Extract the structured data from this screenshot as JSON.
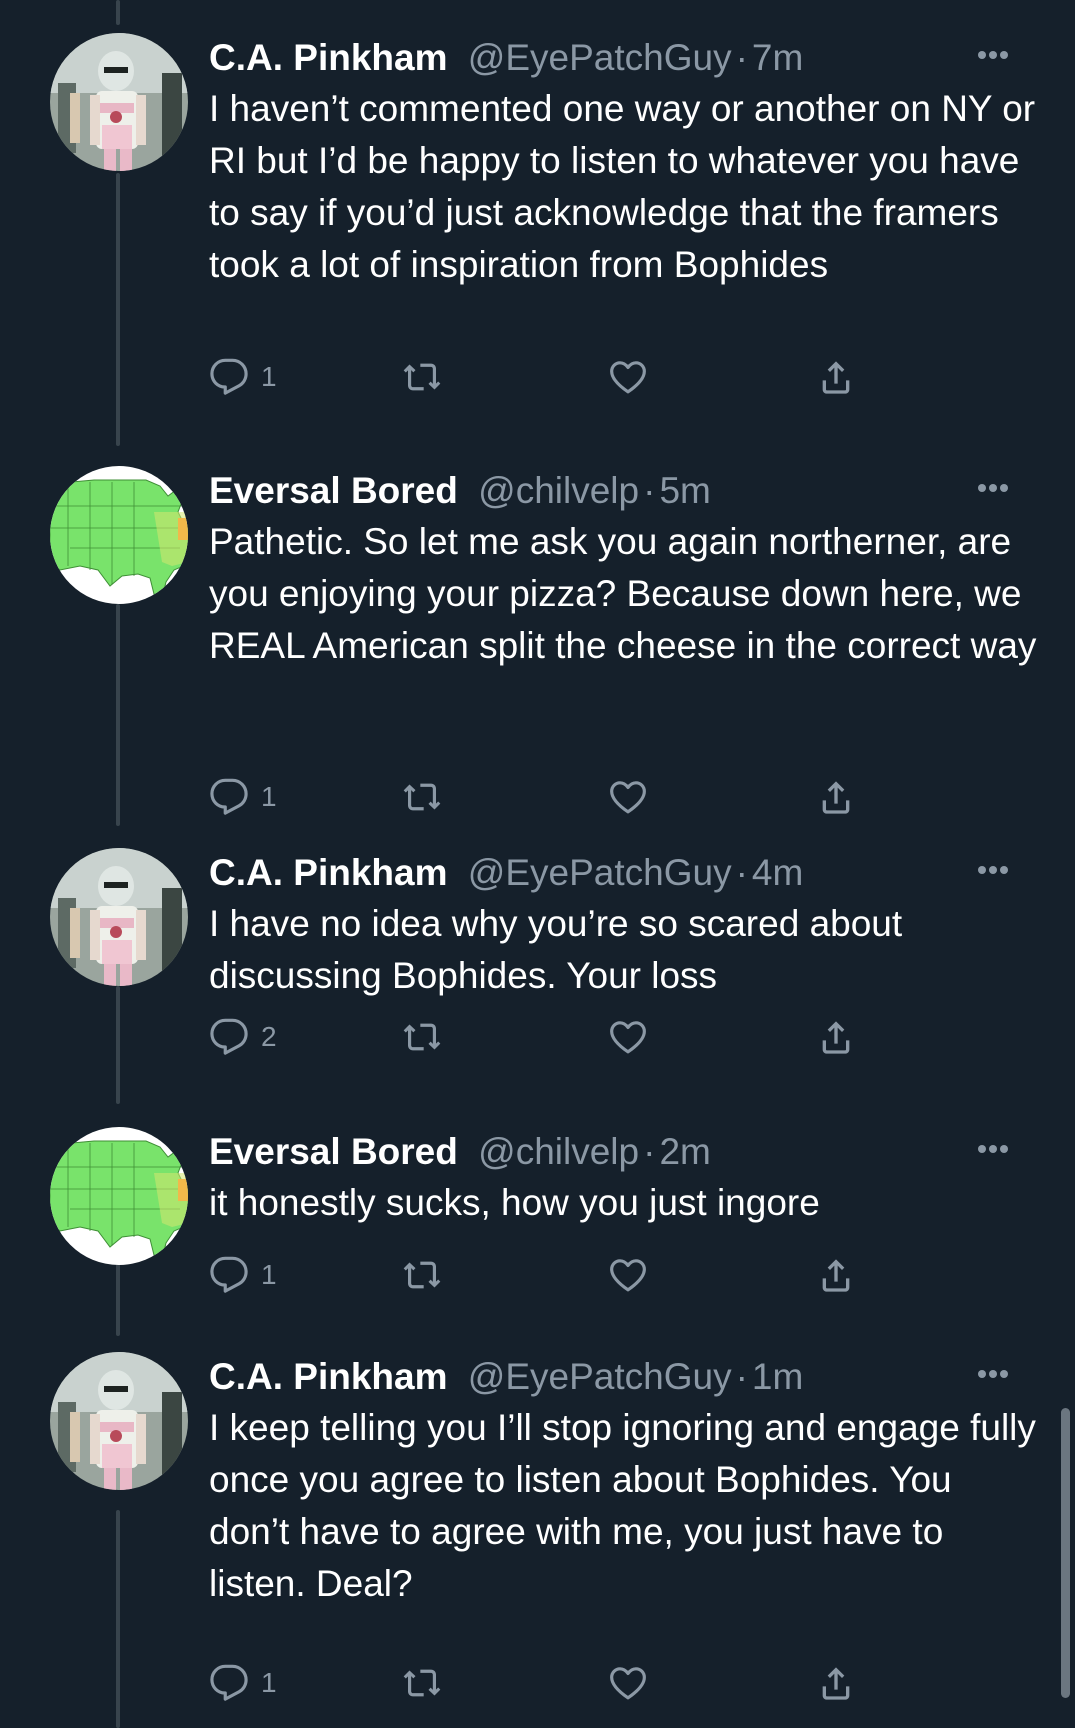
{
  "tweets": [
    {
      "name": "C.A. Pinkham",
      "handle": "@EyePatchGuy",
      "dot": "·",
      "time": "7m",
      "avatar_icon": "stormtrooper-avatar-icon",
      "text": "I haven’t commented one way or another on NY or RI but I’d be happy to listen to whatever you have to say if you’d just acknowledge that the framers took a lot of inspiration from Bophides",
      "reply_count": "1",
      "retweet_count": "",
      "like_count": ""
    },
    {
      "name": "Eversal Bored",
      "handle": "@chilvelp",
      "dot": "·",
      "time": "5m",
      "avatar_icon": "us-map-avatar-icon",
      "text": "Pathetic. So let me ask you again northerner, are you enjoying your pizza? Because down here, we REAL American split the cheese in the correct way",
      "reply_count": "1",
      "retweet_count": "",
      "like_count": ""
    },
    {
      "name": "C.A. Pinkham",
      "handle": "@EyePatchGuy",
      "dot": "·",
      "time": "4m",
      "avatar_icon": "stormtrooper-avatar-icon",
      "text": "I have no idea why you’re so scared about discussing Bophides. Your loss",
      "reply_count": "2",
      "retweet_count": "",
      "like_count": ""
    },
    {
      "name": "Eversal Bored",
      "handle": "@chilvelp",
      "dot": "·",
      "time": "2m",
      "avatar_icon": "us-map-avatar-icon",
      "text": "it honestly sucks, how you just ingore",
      "reply_count": "1",
      "retweet_count": "",
      "like_count": ""
    },
    {
      "name": "C.A. Pinkham",
      "handle": "@EyePatchGuy",
      "dot": "·",
      "time": "1m",
      "avatar_icon": "stormtrooper-avatar-icon",
      "text": "I keep telling you I’ll stop ignoring and engage fully once you agree to listen about Bophides. You don’t have to agree with me, you just have to listen. Deal?",
      "reply_count": "1",
      "retweet_count": "",
      "like_count": ""
    }
  ],
  "icons": {
    "reply": "reply-icon",
    "retweet": "retweet-icon",
    "like": "heart-icon",
    "share": "share-icon",
    "more": "more-options-icon"
  },
  "colors": {
    "background": "#15202b",
    "secondary_text": "#8b98a5",
    "thread_line": "#38444d",
    "map_green": "#79e36b"
  }
}
